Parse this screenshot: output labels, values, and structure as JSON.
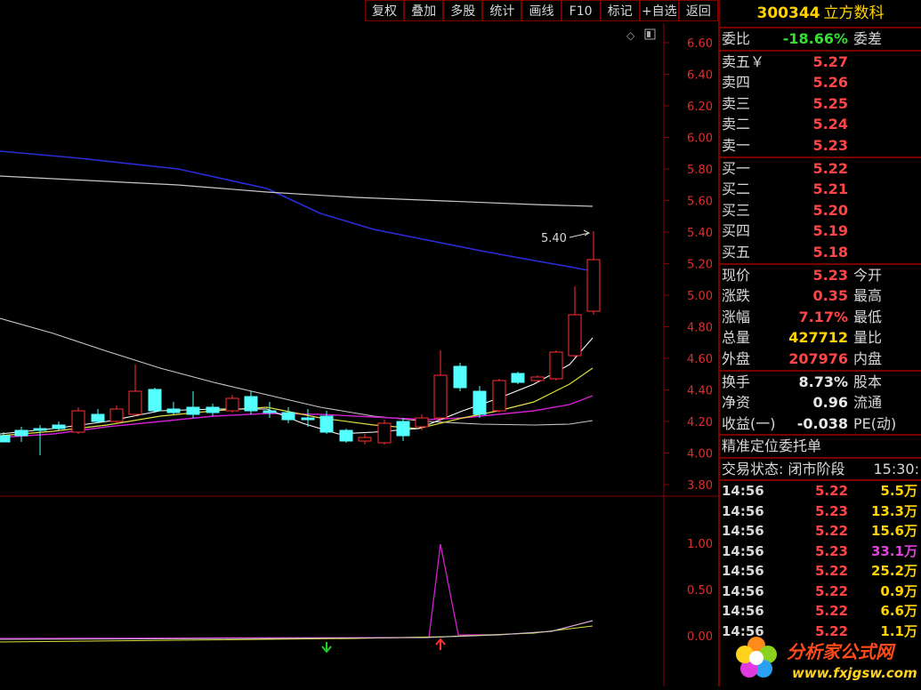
{
  "toolbar": [
    "复权",
    "叠加",
    "多股",
    "统计",
    "画线",
    "F10",
    "标记",
    "+自选",
    "返回"
  ],
  "stock": {
    "code": "300344",
    "name": "立方数科"
  },
  "price_axis": [
    "6.60",
    "6.40",
    "6.20",
    "6.00",
    "5.80",
    "5.60",
    "5.40",
    "5.20",
    "5.00",
    "4.80",
    "4.60",
    "4.40",
    "4.20",
    "4.00",
    "3.80"
  ],
  "indicator_axis": [
    "1.00",
    "0.50",
    "0.00"
  ],
  "annotation": "5.40",
  "weibi": {
    "label": "委比",
    "value": "-18.66%",
    "label2": "委差"
  },
  "sell": [
    {
      "label": "卖五￥",
      "price": "5.27"
    },
    {
      "label": "卖四",
      "price": "5.26"
    },
    {
      "label": "卖三",
      "price": "5.25"
    },
    {
      "label": "卖二",
      "price": "5.24"
    },
    {
      "label": "卖一",
      "price": "5.23"
    }
  ],
  "buy": [
    {
      "label": "买一",
      "price": "5.22"
    },
    {
      "label": "买二",
      "price": "5.21"
    },
    {
      "label": "买三",
      "price": "5.20"
    },
    {
      "label": "买四",
      "price": "5.19"
    },
    {
      "label": "买五",
      "price": "5.18"
    }
  ],
  "quote": [
    {
      "label": "现价",
      "value": "5.23",
      "label2": "今开",
      "color": "red"
    },
    {
      "label": "涨跌",
      "value": "0.35",
      "label2": "最高",
      "color": "red"
    },
    {
      "label": "涨幅",
      "value": "7.17%",
      "label2": "最低",
      "color": "red"
    },
    {
      "label": "总量",
      "value": "427712",
      "label2": "量比",
      "color": "yel"
    },
    {
      "label": "外盘",
      "value": "207976",
      "label2": "内盘",
      "color": "red"
    }
  ],
  "fin": [
    {
      "label": "换手",
      "value": "8.73%",
      "label2": "股本"
    },
    {
      "label": "净资",
      "value": "0.96",
      "label2": "流通"
    },
    {
      "label": "收益(一)",
      "value": "-0.038",
      "label2": "PE(动)"
    }
  ],
  "precise": "精准定位委托单",
  "trade_status": "交易状态: 闭市阶段",
  "trade_time": "15:30:",
  "ticks": [
    {
      "time": "14:56",
      "price": "5.22",
      "vol": "5.5万",
      "color": "yel"
    },
    {
      "time": "14:56",
      "price": "5.23",
      "vol": "13.3万",
      "color": "yel"
    },
    {
      "time": "14:56",
      "price": "5.22",
      "vol": "15.6万",
      "color": "yel"
    },
    {
      "time": "14:56",
      "price": "5.23",
      "vol": "33.1万",
      "color": "mag"
    },
    {
      "time": "14:56",
      "price": "5.22",
      "vol": "25.2万",
      "color": "yel"
    },
    {
      "time": "14:56",
      "price": "5.22",
      "vol": "0.9万",
      "color": "yel"
    },
    {
      "time": "14:56",
      "price": "5.22",
      "vol": "6.6万",
      "color": "yel"
    },
    {
      "time": "14:56",
      "price": "5.22",
      "vol": "1.1万",
      "color": "yel"
    }
  ],
  "logo": {
    "title": "分析家公式网",
    "url": "www.fxjgsw.com"
  }
}
